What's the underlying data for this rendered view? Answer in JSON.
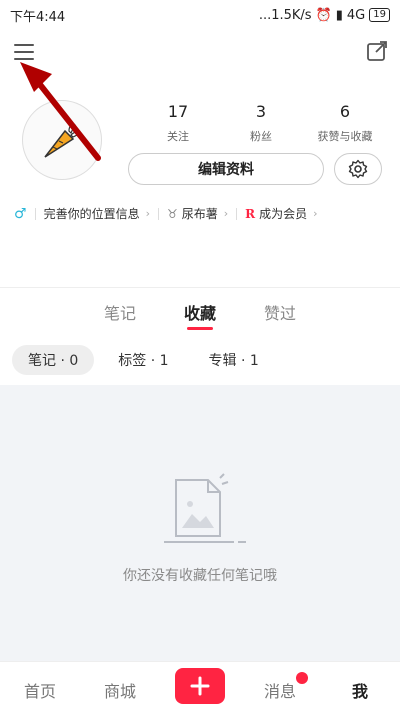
{
  "status_bar": {
    "time": "下午4:44",
    "network_speed": "...1.5K/s",
    "network_type": "4G",
    "battery": "19"
  },
  "profile": {
    "stats": [
      {
        "value": "17",
        "label": "关注"
      },
      {
        "value": "3",
        "label": "粉丝"
      },
      {
        "value": "6",
        "label": "获赞与收藏"
      }
    ],
    "edit_label": "编辑资料",
    "info": [
      {
        "icon": "male-icon",
        "text": "完善你的位置信息"
      },
      {
        "icon": "zodiac-icon",
        "text": "尿布薯"
      },
      {
        "icon": "vip-icon",
        "text": "成为会员"
      }
    ]
  },
  "tabs": [
    "笔记",
    "收藏",
    "赞过"
  ],
  "active_tab": "收藏",
  "chips": [
    "笔记 · 0",
    "标签 · 1",
    "专辑 · 1"
  ],
  "empty_message": "你还没有收藏任何笔记哦",
  "bottom_nav": {
    "items": [
      "首页",
      "商城",
      "消息",
      "我"
    ],
    "active": "我"
  },
  "colors": {
    "accent": "#ff2442",
    "annotation_arrow": "#b00000"
  }
}
